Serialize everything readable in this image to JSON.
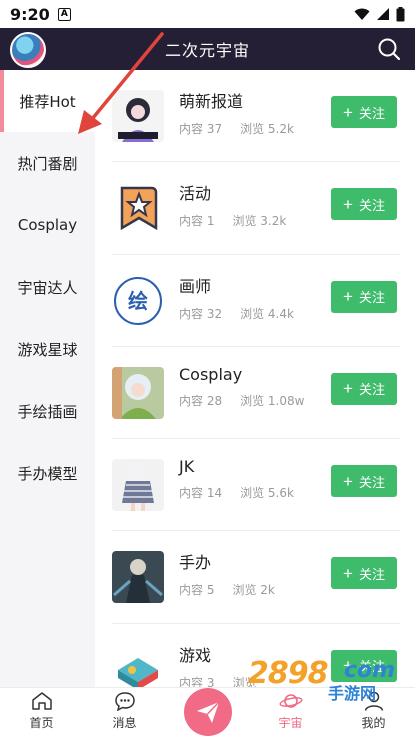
{
  "status_bar": {
    "time": "9:20",
    "badge": "A"
  },
  "header": {
    "title": "二次元宇宙"
  },
  "sidebar": {
    "items": [
      {
        "label": "推荐Hot",
        "active": true
      },
      {
        "label": "热门番剧"
      },
      {
        "label": "Cosplay"
      },
      {
        "label": "宇宙达人"
      },
      {
        "label": "游戏星球"
      },
      {
        "label": "手绘插画"
      },
      {
        "label": "手办模型"
      }
    ]
  },
  "list": {
    "follow_label": "关注",
    "items": [
      {
        "name": "萌新报道",
        "content": "内容 37",
        "views": "浏览 5.2k"
      },
      {
        "name": "活动",
        "content": "内容 1",
        "views": "浏览 3.2k"
      },
      {
        "name": "画师",
        "content": "内容 32",
        "views": "浏览 4.4k"
      },
      {
        "name": "Cosplay",
        "content": "内容 28",
        "views": "浏览 1.08w"
      },
      {
        "name": "JK",
        "content": "内容 14",
        "views": "浏览 5.6k"
      },
      {
        "name": "手办",
        "content": "内容 5",
        "views": "浏览 2k"
      },
      {
        "name": "游戏",
        "content": "内容 3",
        "views": "浏览"
      }
    ]
  },
  "tabbar": {
    "items": [
      {
        "label": "首页",
        "icon": "home-icon"
      },
      {
        "label": "消息",
        "icon": "message-icon"
      },
      {
        "label": "",
        "icon": "send-icon"
      },
      {
        "label": "宇宙",
        "icon": "planet-icon",
        "active": true
      },
      {
        "label": "我的",
        "icon": "profile-icon"
      }
    ]
  },
  "watermark": {
    "number": "2898",
    "domain": "com",
    "sub": "手游网"
  },
  "colors": {
    "header_bg": "#241f35",
    "follow_green": "#3ebc6b",
    "accent_pink": "#f06a86",
    "active_bar": "#f28b9c"
  }
}
